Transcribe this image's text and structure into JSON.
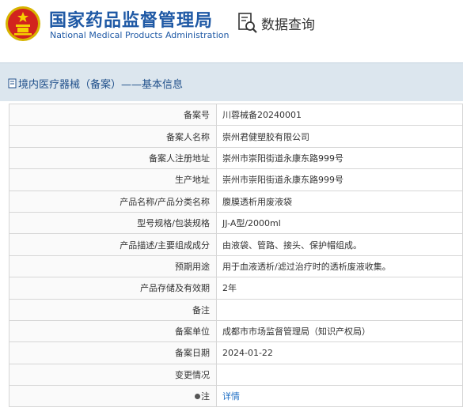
{
  "header": {
    "agency_cn": "国家药品监督管理局",
    "agency_en": "National Medical Products Administration",
    "query_label": "数据查询"
  },
  "breadcrumb": "境内医疗器械（备案）——基本信息",
  "rows": [
    {
      "label": "备案号",
      "value": "川蓉械备20240001"
    },
    {
      "label": "备案人名称",
      "value": "崇州君健塑胶有限公司"
    },
    {
      "label": "备案人注册地址",
      "value": "崇州市崇阳街道永康东路999号"
    },
    {
      "label": "生产地址",
      "value": "崇州市崇阳街道永康东路999号"
    },
    {
      "label": "产品名称/产品分类名称",
      "value": "腹膜透析用废液袋"
    },
    {
      "label": "型号规格/包装规格",
      "value": "JJ-A型/2000ml"
    },
    {
      "label": "产品描述/主要组成成分",
      "value": "由液袋、管路、接头、保护帽组成。"
    },
    {
      "label": "预期用途",
      "value": "用于血液透析/滤过治疗时的透析废液收集。"
    },
    {
      "label": "产品存储及有效期",
      "value": "2年"
    },
    {
      "label": "备注",
      "value": ""
    },
    {
      "label": "备案单位",
      "value": "成都市市场监督管理局（知识产权局）"
    },
    {
      "label": "备案日期",
      "value": "2024-01-22"
    },
    {
      "label": "变更情况",
      "value": ""
    }
  ],
  "note_row": {
    "label": "注",
    "link": "详情"
  },
  "colors": {
    "brand_blue": "#1f59a5",
    "bar_bg": "#dce6ee",
    "link": "#1f6fc5"
  }
}
